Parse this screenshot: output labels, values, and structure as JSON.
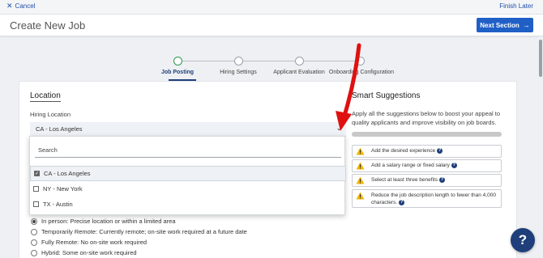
{
  "topbar": {
    "cancel_label": "Cancel",
    "finish_label": "Finish Later"
  },
  "header": {
    "title": "Create New Job",
    "next_label": "Next Section"
  },
  "stepper": {
    "steps": [
      {
        "label": "Job Posting",
        "active": true
      },
      {
        "label": "Hiring Settings",
        "active": false
      },
      {
        "label": "Applicant Evaluation",
        "active": false
      },
      {
        "label": "Onboarding Configuration",
        "active": false
      }
    ]
  },
  "location": {
    "section_title": "Location",
    "field_label": "Hiring Location",
    "selected_value": "CA - Los Angeles",
    "search_placeholder": "Search",
    "options": [
      {
        "label": "CA - Los Angeles",
        "checked": true
      },
      {
        "label": "NY - New York",
        "checked": false
      },
      {
        "label": "TX - Austin",
        "checked": false
      }
    ]
  },
  "work_type": {
    "options": [
      {
        "label": "In person: Precise location or within a limited area",
        "selected": true
      },
      {
        "label": "Temporarily Remote: Currently remote; on-site work required at a future date",
        "selected": false
      },
      {
        "label": "Fully Remote: No on-site work required",
        "selected": false
      },
      {
        "label": "Hybrid: Some on-site work required",
        "selected": false
      }
    ]
  },
  "smart": {
    "title": "Smart Suggestions",
    "description": "Apply all the suggestions below to boost your appeal to quality applicants and improve visibility on job boards.",
    "suggestions": [
      "Add the desired experience",
      "Add a salary range or fixed salary",
      "Select at least three benefits",
      "Reduce the job description length to fewer than 4,000 characters."
    ]
  },
  "help_fab_label": "?",
  "colors": {
    "primary": "#1f5fc6",
    "navy": "#1f3f7a",
    "active_step": "#2d9a4b",
    "warning": "#f2b600",
    "annotation": "#e01010"
  },
  "icons": [
    "close-icon",
    "arrow-right-icon",
    "chevron-down-icon",
    "checkbox-icon",
    "radio-icon",
    "warning-icon",
    "help-icon"
  ]
}
